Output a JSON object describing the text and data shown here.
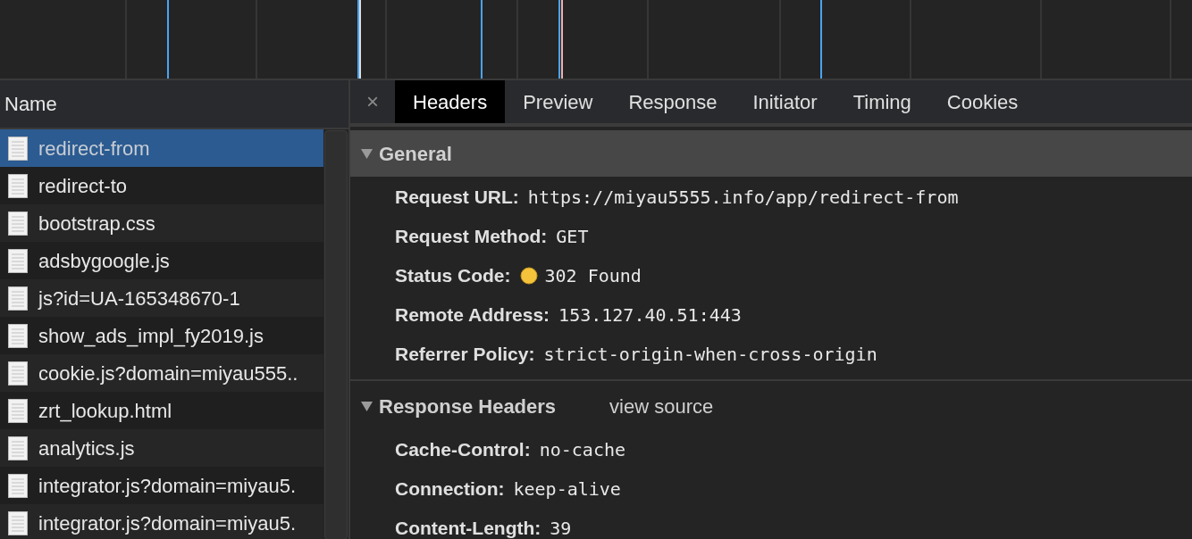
{
  "requests": {
    "column_header": "Name",
    "items": [
      {
        "name": "redirect-from",
        "selected": true
      },
      {
        "name": "redirect-to",
        "selected": false
      },
      {
        "name": "bootstrap.css",
        "selected": false
      },
      {
        "name": "adsbygoogle.js",
        "selected": false
      },
      {
        "name": "js?id=UA-165348670-1",
        "selected": false
      },
      {
        "name": "show_ads_impl_fy2019.js",
        "selected": false
      },
      {
        "name": "cookie.js?domain=miyau555..",
        "selected": false
      },
      {
        "name": "zrt_lookup.html",
        "selected": false
      },
      {
        "name": "analytics.js",
        "selected": false
      },
      {
        "name": "integrator.js?domain=miyau5.",
        "selected": false
      },
      {
        "name": "integrator.js?domain=miyau5.",
        "selected": false
      }
    ]
  },
  "details": {
    "close": "×",
    "tabs": [
      {
        "label": "Headers",
        "selected": true
      },
      {
        "label": "Preview",
        "selected": false
      },
      {
        "label": "Response",
        "selected": false
      },
      {
        "label": "Initiator",
        "selected": false
      },
      {
        "label": "Timing",
        "selected": false
      },
      {
        "label": "Cookies",
        "selected": false
      }
    ],
    "sections": [
      {
        "title": "General",
        "expanded": true,
        "highlighted": true,
        "fields": [
          {
            "name": "Request URL:",
            "value": "https://miyau5555.info/app/redirect-from"
          },
          {
            "name": "Request Method:",
            "value": "GET"
          },
          {
            "kind": "status",
            "name": "Status Code:",
            "value": "302 Found"
          },
          {
            "name": "Remote Address:",
            "value": "153.127.40.51:443"
          },
          {
            "name": "Referrer Policy:",
            "value": "strict-origin-when-cross-origin"
          }
        ]
      },
      {
        "title": "Response Headers",
        "expanded": true,
        "highlighted": false,
        "link": "view source",
        "fields": [
          {
            "name": "Cache-Control:",
            "value": "no-cache"
          },
          {
            "name": "Connection:",
            "value": "keep-alive"
          },
          {
            "name": "Content-Length:",
            "value": "39"
          }
        ]
      }
    ]
  }
}
